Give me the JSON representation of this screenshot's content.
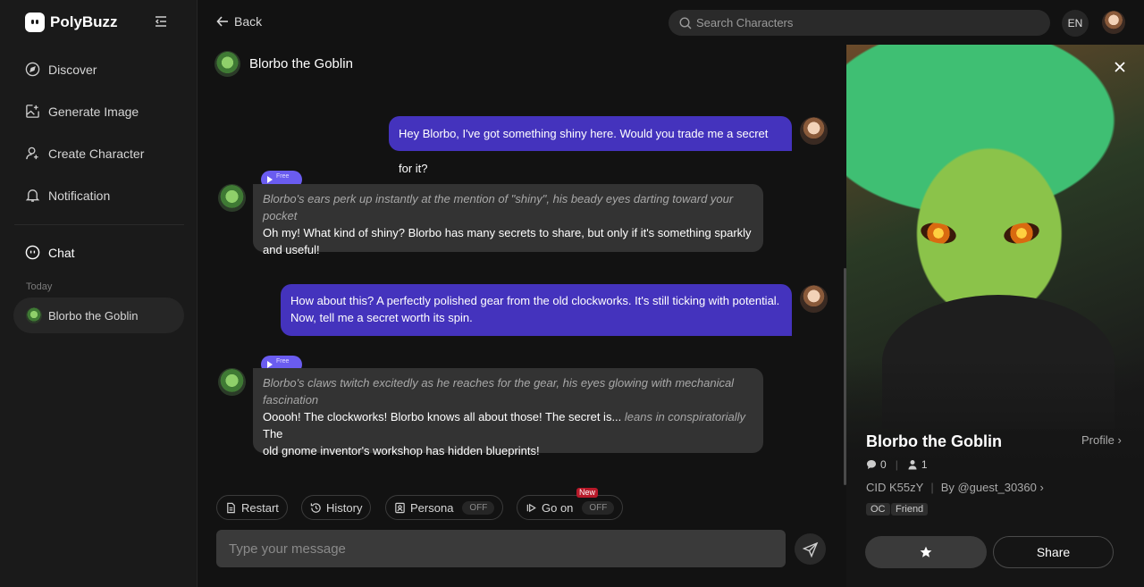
{
  "brand": {
    "name": "PolyBuzz"
  },
  "sidebar": {
    "nav": [
      {
        "label": "Discover",
        "icon": "compass-icon"
      },
      {
        "label": "Generate Image",
        "icon": "image-sparkle-icon"
      },
      {
        "label": "Create Character",
        "icon": "user-plus-icon"
      },
      {
        "label": "Notification",
        "icon": "bell-icon"
      }
    ],
    "chat_label": "Chat",
    "section_today": "Today",
    "recent_chats": [
      {
        "name": "Blorbo the Goblin"
      }
    ]
  },
  "topbar": {
    "back_label": "Back",
    "search_placeholder": "Search Characters",
    "language": "EN"
  },
  "chat": {
    "character_name": "Blorbo the Goblin",
    "messages": [
      {
        "role": "user",
        "text": "Hey Blorbo, I've got something shiny here. Would you trade me a secret for it?"
      },
      {
        "role": "bot",
        "badge": "Free",
        "action": "Blorbo's ears perk up instantly at the mention of \"shiny\", his beady eyes darting toward your pocket",
        "text": "Oh my! What kind of shiny? Blorbo has many secrets to share, but only if it's something sparkly and useful!"
      },
      {
        "role": "user",
        "text_line1": "How about this? A perfectly polished gear from the old clockworks. It's still ticking with potential.",
        "text_line2": "Now, tell me a secret worth its spin."
      },
      {
        "role": "bot",
        "badge": "Free",
        "action_line1": "Blorbo's claws twitch excitedly as he reaches for the gear, his eyes glowing with mechanical",
        "action_line2": "fascination",
        "text_start": "Ooooh! The clockworks! Blorbo knows all about those! The secret is... ",
        "inline_action": "leans in conspiratorially",
        "text_end": " The",
        "text_line2": "old gnome inventor's workshop has hidden blueprints!"
      }
    ],
    "actions": {
      "restart": "Restart",
      "history": "History",
      "persona": "Persona",
      "persona_state": "OFF",
      "go_on": "Go on",
      "go_on_state": "OFF",
      "new_badge": "New"
    },
    "composer_placeholder": "Type your message"
  },
  "profile_panel": {
    "name": "Blorbo the Goblin",
    "profile_link": "Profile",
    "chats_count": "0",
    "followers_count": "1",
    "cid": "CID K55zY",
    "author": "By @guest_30360",
    "tags": [
      "OC",
      "Friend"
    ],
    "share_label": "Share"
  },
  "colors": {
    "accent": "#4433bd",
    "badge": "#6a5cf0",
    "background": "#121212"
  }
}
